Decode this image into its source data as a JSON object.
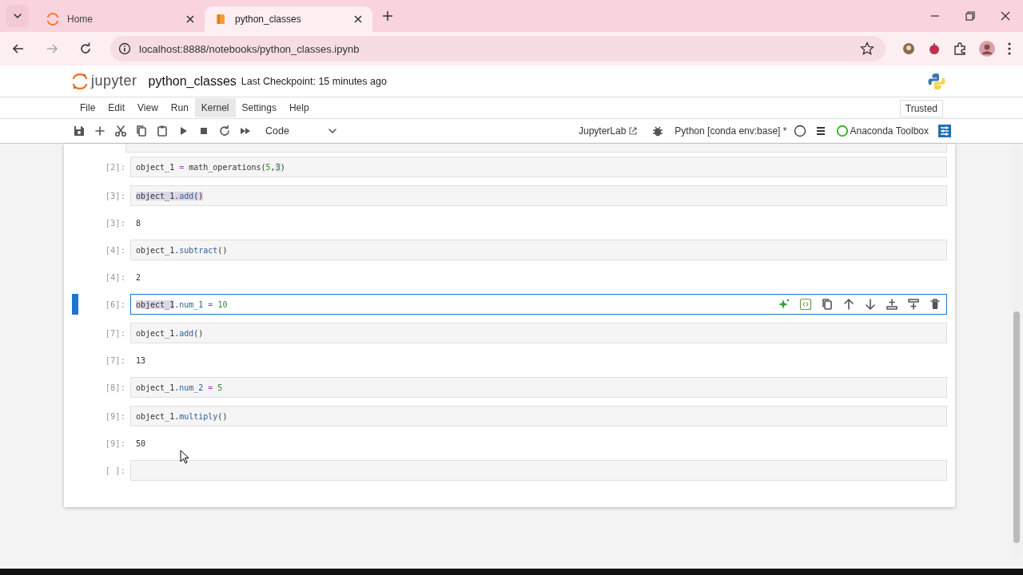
{
  "browser": {
    "tabs": [
      {
        "label": "Home",
        "selected": false
      },
      {
        "label": "python_classes",
        "selected": true
      }
    ],
    "url": "localhost:8888/notebooks/python_classes.ipynb"
  },
  "notebook": {
    "logo": "jupyter",
    "name": "python_classes",
    "checkpoint": "Last Checkpoint: 15 minutes ago",
    "menus": [
      {
        "label": "File",
        "selected": false
      },
      {
        "label": "Edit",
        "selected": false
      },
      {
        "label": "View",
        "selected": false
      },
      {
        "label": "Run",
        "selected": false
      },
      {
        "label": "Kernel",
        "selected": true
      },
      {
        "label": "Settings",
        "selected": false
      },
      {
        "label": "Help",
        "selected": false
      }
    ],
    "trusted": "Trusted",
    "cell_type": "Code",
    "jupyterlab_link": "JupyterLab",
    "kernel": "Python [conda env:base] *",
    "toolbox": "Anaconda Toolbox"
  },
  "cells": [
    {
      "kind": "input",
      "prompt": "[2]:",
      "selected": false,
      "tokens": [
        {
          "text": "object_1 ",
          "kind": "name",
          "highlighted": false
        },
        {
          "text": "=",
          "kind": "op",
          "highlighted": false
        },
        {
          "text": " math_operations(",
          "kind": "name",
          "highlighted": false
        },
        {
          "text": "5",
          "kind": "number",
          "highlighted": false
        },
        {
          "text": ",",
          "kind": "name",
          "highlighted": false
        },
        {
          "text": "3",
          "kind": "number",
          "highlighted": true
        },
        {
          "text": ")",
          "kind": "name",
          "highlighted": false
        }
      ]
    },
    {
      "kind": "input",
      "prompt": "[3]:",
      "selected": false,
      "tokens": [
        {
          "text": "object_1.",
          "kind": "name",
          "highlighted": true
        },
        {
          "text": "add",
          "kind": "attr",
          "highlighted": true
        },
        {
          "text": "()",
          "kind": "name",
          "highlighted": true
        }
      ]
    },
    {
      "kind": "output",
      "prompt": "[3]:",
      "text": "8"
    },
    {
      "kind": "input",
      "prompt": "[4]:",
      "selected": false,
      "tokens": [
        {
          "text": "object_1.",
          "kind": "name",
          "highlighted": false
        },
        {
          "text": "subtract",
          "kind": "attr",
          "highlighted": false
        },
        {
          "text": "()",
          "kind": "name",
          "highlighted": false
        }
      ]
    },
    {
      "kind": "output",
      "prompt": "[4]:",
      "text": "2"
    },
    {
      "kind": "input",
      "prompt": "[6]:",
      "selected": true,
      "tokens": [
        {
          "text": "object_1",
          "kind": "name",
          "highlighted": true
        },
        {
          "text": ".",
          "kind": "name",
          "highlighted": false
        },
        {
          "text": "num_1",
          "kind": "attr",
          "highlighted": false
        },
        {
          "text": " = ",
          "kind": "op",
          "highlighted": false
        },
        {
          "text": "10",
          "kind": "number",
          "highlighted": false
        }
      ]
    },
    {
      "kind": "input",
      "prompt": "[7]:",
      "selected": false,
      "tokens": [
        {
          "text": "object_1.",
          "kind": "name",
          "highlighted": false
        },
        {
          "text": "add",
          "kind": "attr",
          "highlighted": false
        },
        {
          "text": "()",
          "kind": "name",
          "highlighted": false
        }
      ]
    },
    {
      "kind": "output",
      "prompt": "[7]:",
      "text": "13"
    },
    {
      "kind": "input",
      "prompt": "[8]:",
      "selected": false,
      "tokens": [
        {
          "text": "object_1.",
          "kind": "name",
          "highlighted": false
        },
        {
          "text": "num_2",
          "kind": "attr",
          "highlighted": false
        },
        {
          "text": " = ",
          "kind": "op",
          "highlighted": false
        },
        {
          "text": "5",
          "kind": "number",
          "highlighted": false
        }
      ]
    },
    {
      "kind": "input",
      "prompt": "[9]:",
      "selected": false,
      "tokens": [
        {
          "text": "object_1.",
          "kind": "name",
          "highlighted": false
        },
        {
          "text": "multiply",
          "kind": "attr",
          "highlighted": false
        },
        {
          "text": "()",
          "kind": "name",
          "highlighted": false
        }
      ]
    },
    {
      "kind": "output",
      "prompt": "[9]:",
      "text": "50"
    },
    {
      "kind": "input",
      "prompt": "[ ]:",
      "selected": false
    }
  ]
}
